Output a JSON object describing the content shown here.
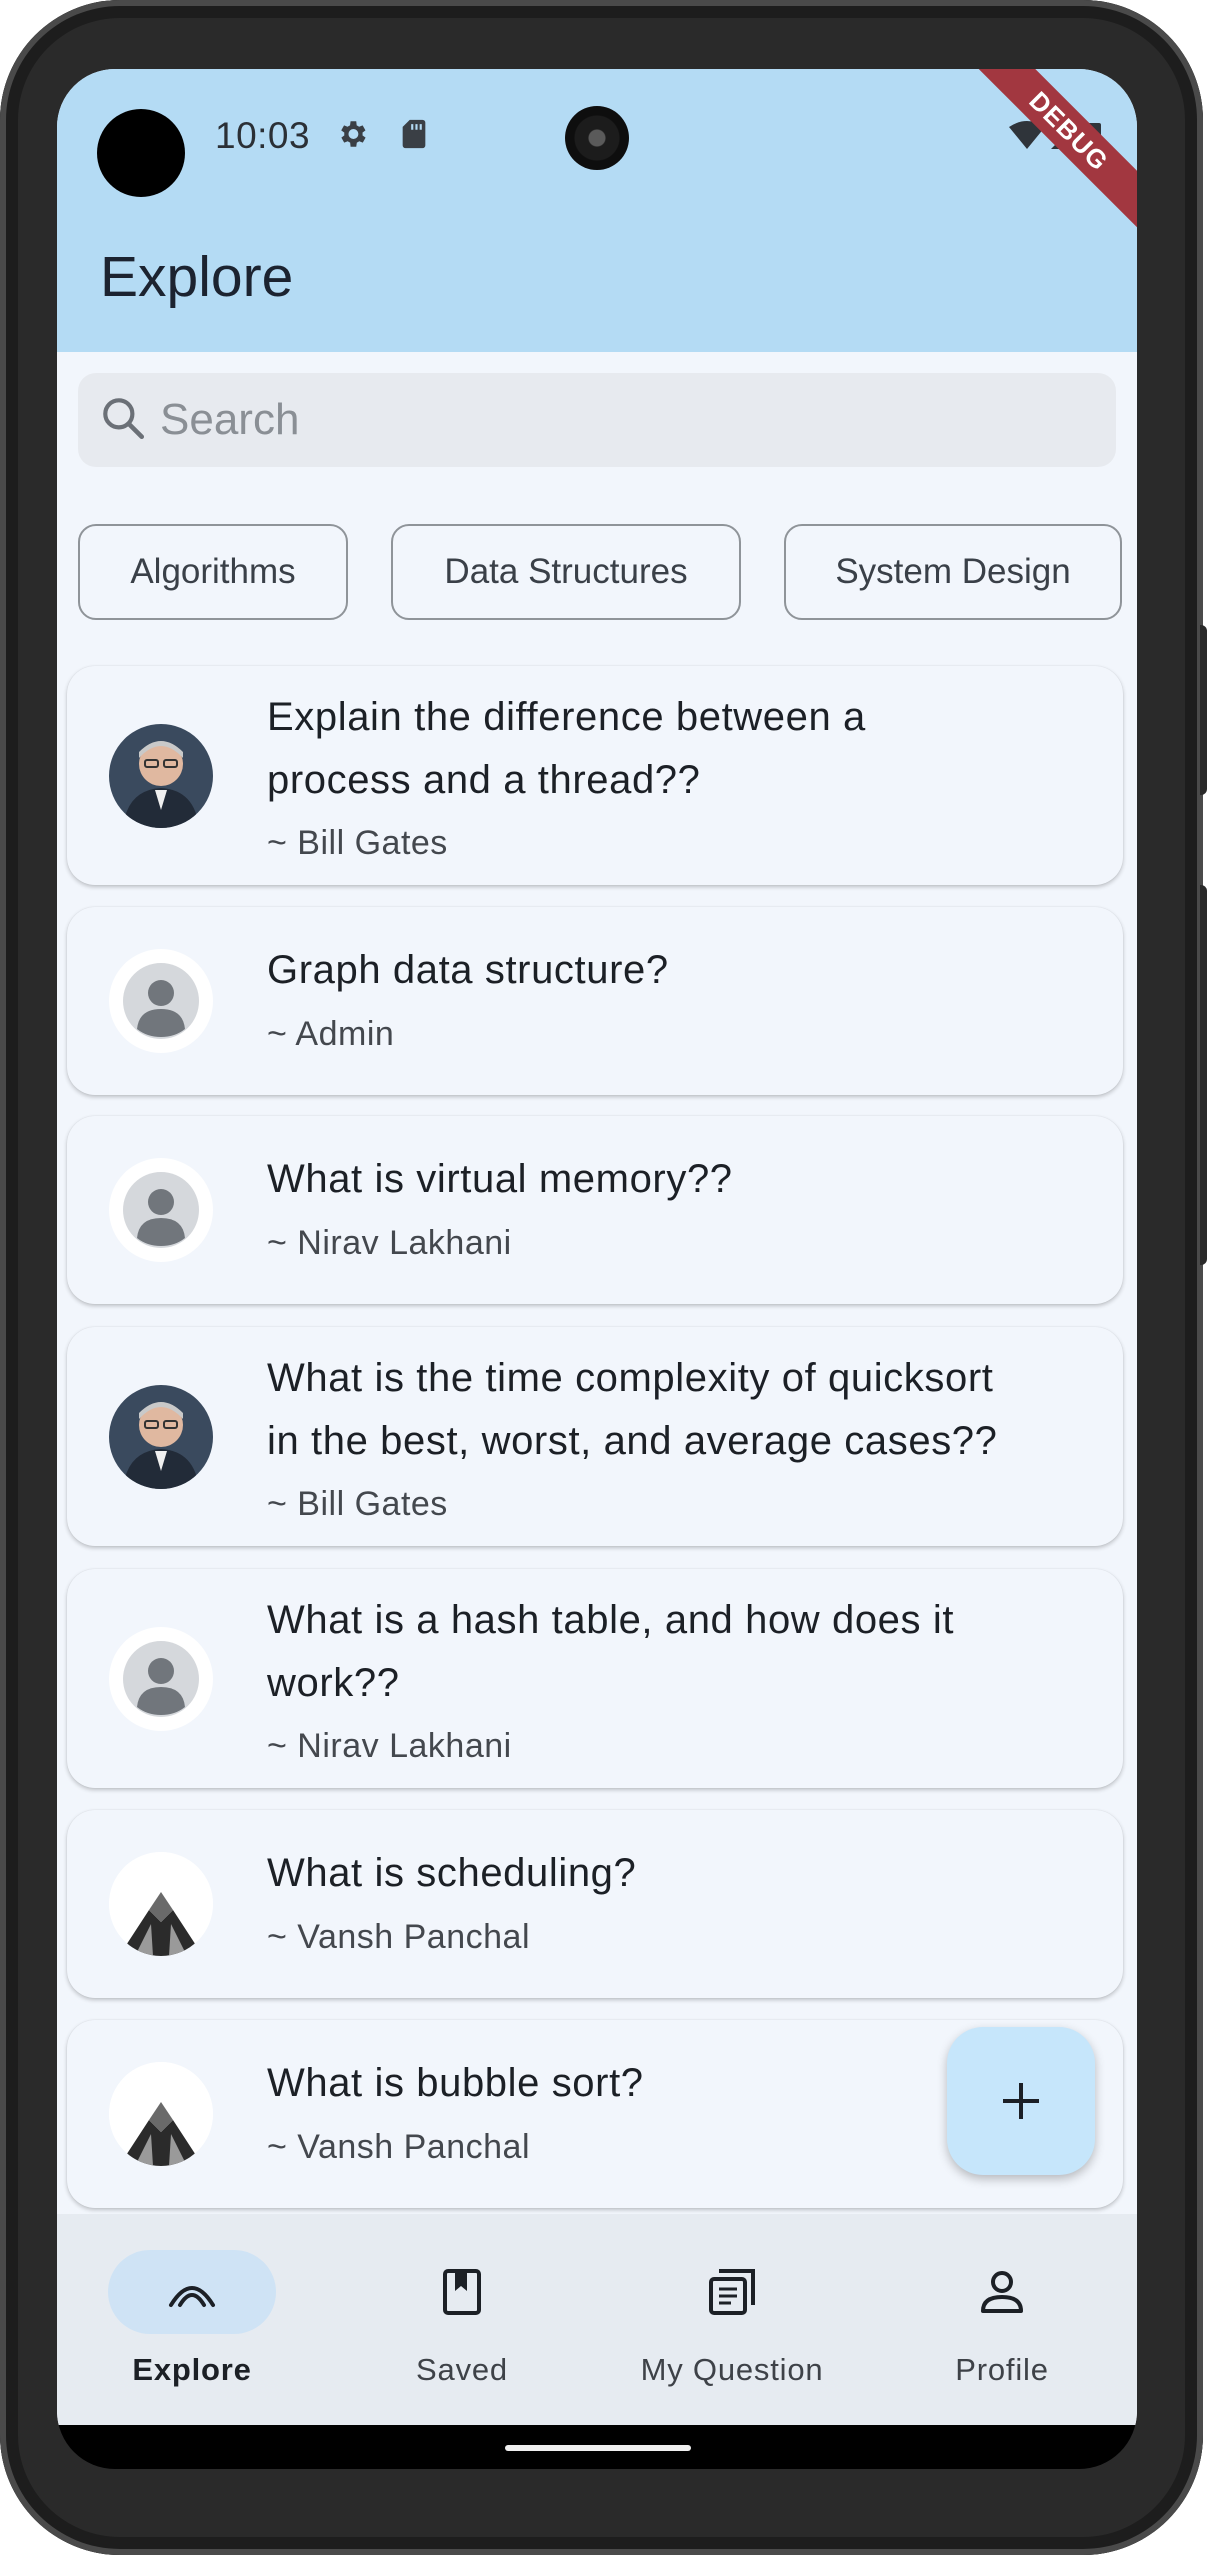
{
  "status_bar": {
    "time": "10:03",
    "debug_banner": "DEBUG"
  },
  "header": {
    "title": "Explore"
  },
  "search": {
    "placeholder": "Search"
  },
  "chips": [
    "Algorithms",
    "Data Structures",
    "System Design"
  ],
  "questions": [
    {
      "lines": [
        "Explain the difference between a",
        "process and a thread??"
      ],
      "author": "~ Bill Gates",
      "avatar": "photo-portrait"
    },
    {
      "lines": [
        "Graph data structure?"
      ],
      "author": "~ Admin",
      "avatar": "default-person"
    },
    {
      "lines": [
        "What is virtual memory??"
      ],
      "author": "~ Nirav Lakhani",
      "avatar": "default-person"
    },
    {
      "lines": [
        "What is the time complexity of quicksort",
        "in the best, worst, and average cases??"
      ],
      "author": "~ Bill Gates",
      "avatar": "photo-portrait"
    },
    {
      "lines": [
        "What is a hash table, and how does it",
        "work??"
      ],
      "author": "~ Nirav Lakhani",
      "avatar": "default-person"
    },
    {
      "lines": [
        "What is scheduling?"
      ],
      "author": "~ Vansh Panchal",
      "avatar": "building-photo"
    },
    {
      "lines": [
        "What is bubble sort?"
      ],
      "author": "~ Vansh Panchal",
      "avatar": "building-photo"
    }
  ],
  "fab": {
    "icon": "plus-icon"
  },
  "nav": [
    {
      "label": "Explore",
      "icon": "explore-arc-icon",
      "active": true
    },
    {
      "label": "Saved",
      "icon": "bookmark-icon",
      "active": false
    },
    {
      "label": "My Question",
      "icon": "article-icon",
      "active": false
    },
    {
      "label": "Profile",
      "icon": "person-icon",
      "active": false
    }
  ],
  "colors": {
    "header_bg": "#b4dbf4",
    "page_bg": "#f2f6fc",
    "nav_bg": "#e6ebf1",
    "nav_pill": "#cfe3f5",
    "fab_bg": "#c6e6fb",
    "debug_banner": "#a23740"
  }
}
